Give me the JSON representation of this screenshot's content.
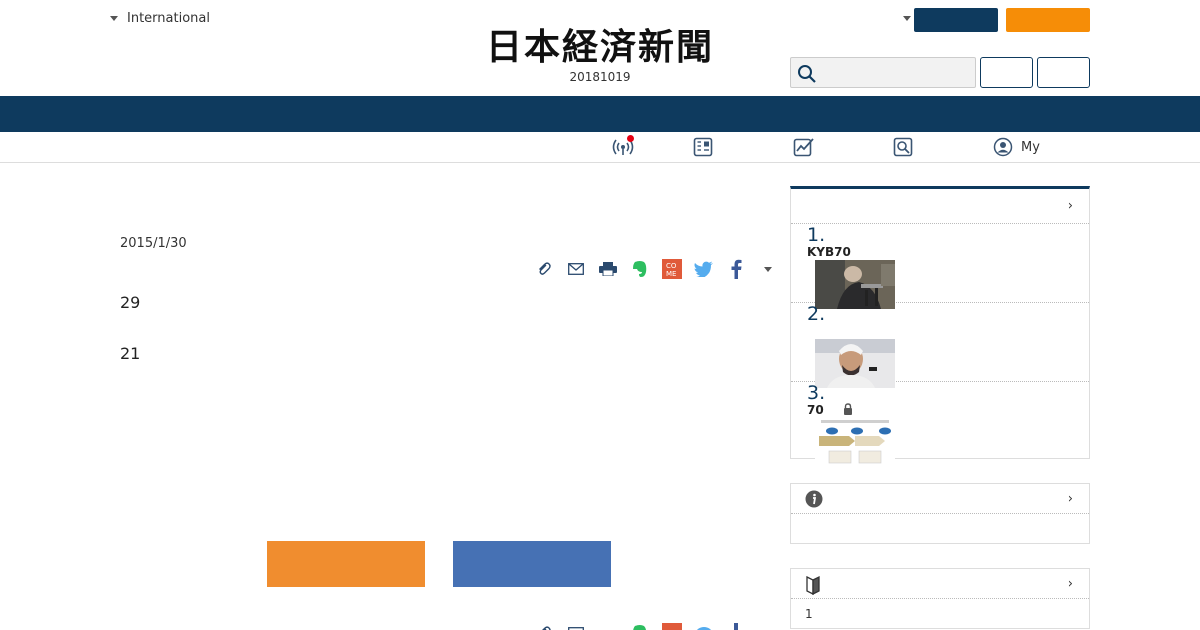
{
  "header": {
    "edition_label": "International",
    "logo_text": "日本経済新聞",
    "date_text": "20181019"
  },
  "subnav": {
    "my_label": "My"
  },
  "article": {
    "date": "2015/1/30",
    "paragraphs": [
      "29",
      "21"
    ]
  },
  "sidebar": {
    "ranking": [
      {
        "num": "1.",
        "title": "KYB70"
      },
      {
        "num": "2.",
        "title": ""
      },
      {
        "num": "3.",
        "title": "70"
      }
    ],
    "beginner_item": "1"
  },
  "colors": {
    "navy": "#0e3a5e",
    "orange": "#f68d07",
    "cta_orange": "#f08d2f",
    "cta_blue": "#4671b4"
  },
  "icons": [
    "broadcast-icon",
    "paper-icon",
    "chart-icon",
    "search-doc-icon",
    "user-icon",
    "clip-icon",
    "mail-icon",
    "print-icon",
    "evernote-icon",
    "come-icon",
    "twitter-icon",
    "facebook-icon",
    "info-icon",
    "beginner-icon",
    "lock-icon"
  ]
}
